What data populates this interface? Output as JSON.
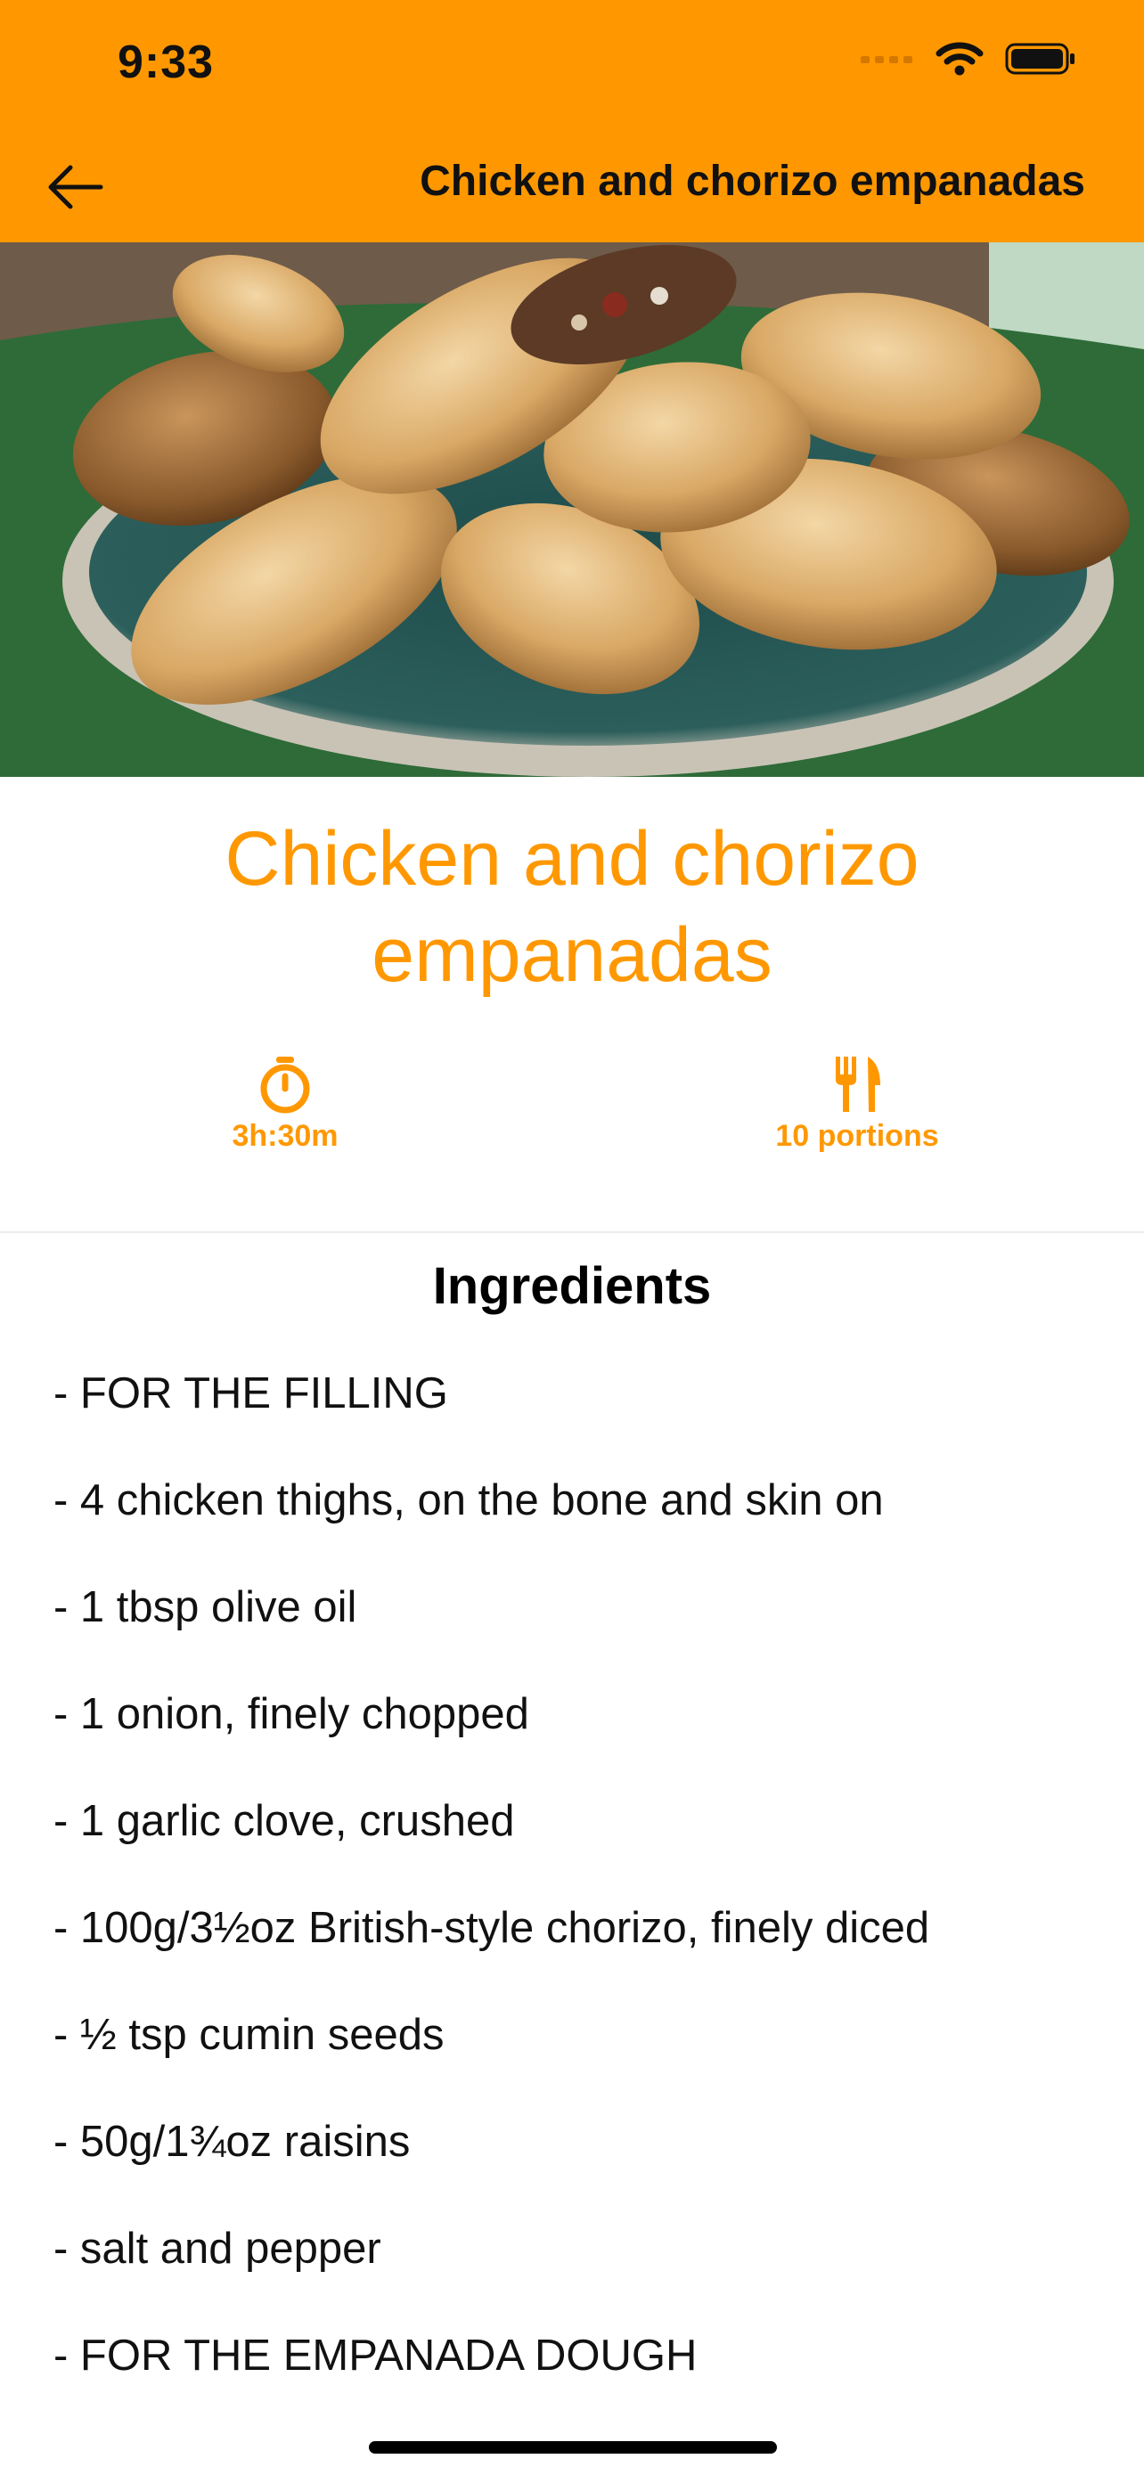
{
  "status_bar": {
    "time": "9:33",
    "icons": [
      "cellular-signal-icon",
      "wifi-icon",
      "battery-icon"
    ]
  },
  "nav": {
    "back_icon": "arrow-left-icon",
    "title": "Chicken and chorizo empanadas"
  },
  "hero": {
    "image": "photo of chicken and chorizo empanadas on a plate"
  },
  "recipe": {
    "title": "Chicken and chorizo empanadas",
    "time_icon": "stopwatch-icon",
    "time": "3h:30m",
    "portions_icon": "fork-knife-icon",
    "portions": "10 portions"
  },
  "ingredients": {
    "heading": "Ingredients",
    "items": [
      "- FOR THE FILLING",
      "- 4 chicken thighs, on the bone and skin on",
      "- 1 tbsp olive oil",
      "- 1 onion, finely chopped",
      "- 1 garlic clove, crushed",
      "- 100g/3½oz British-style chorizo, finely diced",
      "- ½ tsp cumin seeds",
      "- 50g/1¾oz raisins",
      "- salt and pepper",
      "- FOR THE EMPANADA DOUGH"
    ]
  },
  "colors": {
    "accent": "#ff9800",
    "text": "#000000",
    "background": "#ffffff"
  }
}
